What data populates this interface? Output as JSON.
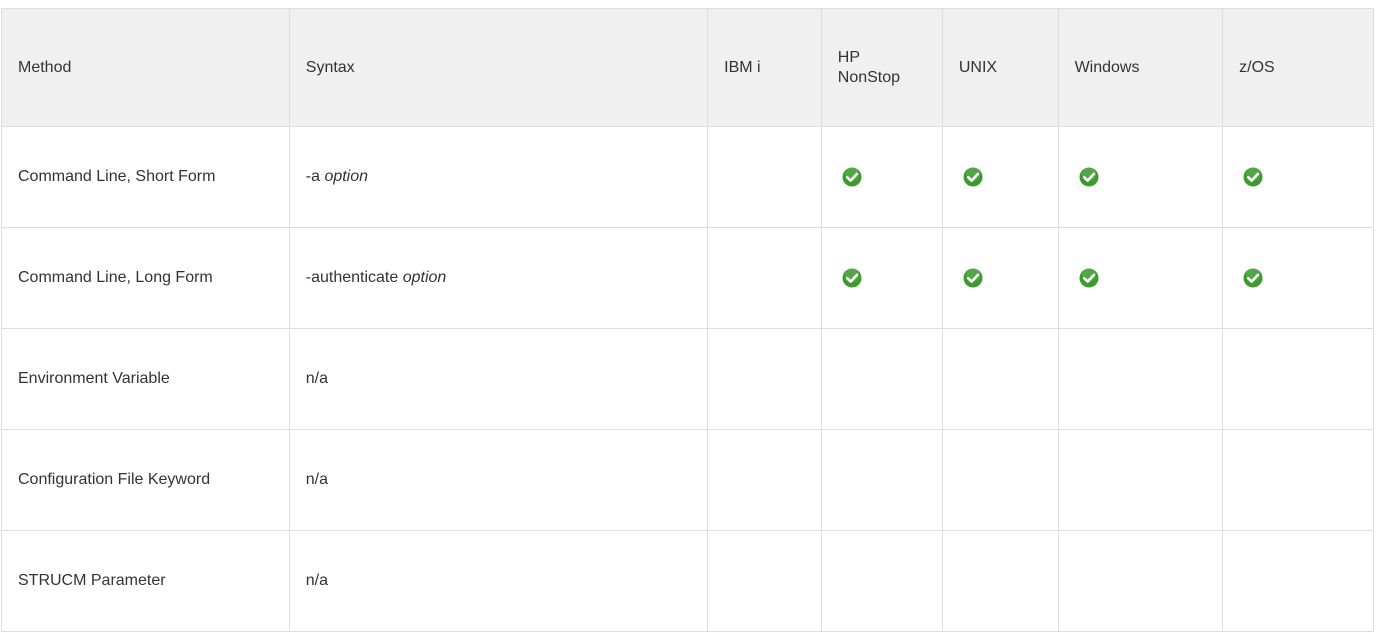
{
  "header": {
    "method": "Method",
    "syntax": "Syntax",
    "ibmi": "IBM i",
    "hp_nonstop": "HP\nNonStop",
    "unix": "UNIX",
    "windows": "Windows",
    "zos": "z/OS"
  },
  "rows": [
    {
      "method": "Command Line, Short Form",
      "syntax_prefix": "-a ",
      "syntax_arg": "option",
      "support": {
        "ibmi": false,
        "hp_nonstop": true,
        "unix": true,
        "windows": true,
        "zos": true
      }
    },
    {
      "method": "Command Line, Long Form",
      "syntax_prefix": "-authenticate ",
      "syntax_arg": "option",
      "support": {
        "ibmi": false,
        "hp_nonstop": true,
        "unix": true,
        "windows": true,
        "zos": true
      }
    },
    {
      "method": "Environment Variable",
      "syntax_prefix": "n/a",
      "syntax_arg": "",
      "support": {
        "ibmi": false,
        "hp_nonstop": false,
        "unix": false,
        "windows": false,
        "zos": false
      }
    },
    {
      "method": "Configuration File Keyword",
      "syntax_prefix": "n/a",
      "syntax_arg": "",
      "support": {
        "ibmi": false,
        "hp_nonstop": false,
        "unix": false,
        "windows": false,
        "zos": false
      }
    },
    {
      "method": "STRUCM Parameter",
      "syntax_prefix": "n/a",
      "syntax_arg": "",
      "support": {
        "ibmi": false,
        "hp_nonstop": false,
        "unix": false,
        "windows": false,
        "zos": false
      }
    }
  ],
  "icons": {
    "supported": "check-circle-icon"
  },
  "colors": {
    "check_fill": "#3c9a2f",
    "header_bg": "#f0f0f0",
    "border": "#dddddd"
  }
}
